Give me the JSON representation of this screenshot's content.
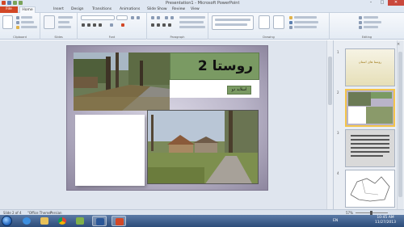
{
  "window": {
    "title": "Presentation1 - Microsoft PowerPoint",
    "min": "–",
    "max": "□",
    "close": "✕"
  },
  "menu": {
    "file": "File",
    "tabs": [
      "Home",
      "Insert",
      "Design",
      "Transitions",
      "Animations",
      "Slide Show",
      "Review",
      "View"
    ]
  },
  "ribbon": {
    "groups": [
      "Clipboard",
      "Slides",
      "Font",
      "Paragraph",
      "Drawing",
      "Editing"
    ]
  },
  "slide": {
    "title": "روستا 2",
    "subtitle": "اسلاید دو"
  },
  "panel": {
    "close": "×",
    "slide_numbers": [
      "1",
      "2",
      "3",
      "4"
    ],
    "thumb1_title": "روستا های استان"
  },
  "status": {
    "slide_info": "Slide 2 of 4",
    "theme": "\"Office Theme\"",
    "language": "Persian",
    "zoom": "57%"
  },
  "taskbar": {
    "lang": "EN",
    "time": "10:45 AM",
    "date": "11/27/2013"
  },
  "colors": {
    "accent_green": "#7a9a63",
    "file_tab": "#d24726",
    "selection": "#f3c44b"
  },
  "icons": [
    "start-orb",
    "internet-explorer-icon",
    "folder-icon",
    "chrome-icon",
    "paint-icon",
    "word-icon",
    "powerpoint-icon"
  ]
}
